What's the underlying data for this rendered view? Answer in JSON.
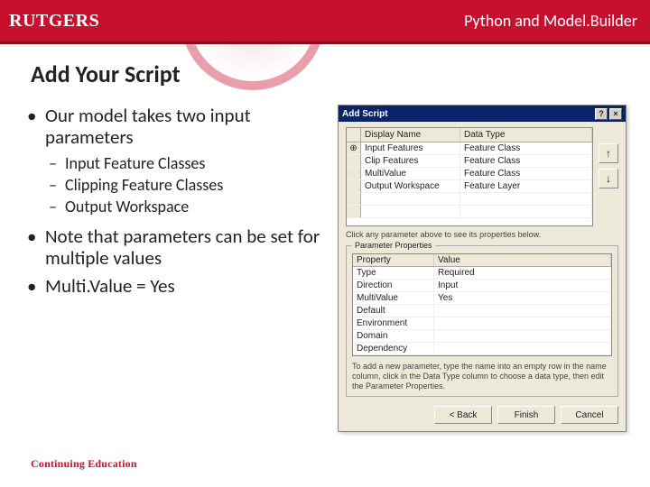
{
  "header": {
    "logo": "RUTGERS",
    "title": "Python and Model.Builder"
  },
  "slide_title": "Add Your Script",
  "bullets": {
    "b1": "Our model takes two input parameters",
    "b1a": "Input Feature Classes",
    "b1b": "Clipping Feature Classes",
    "b1c": "Output Workspace",
    "b2": "Note that parameters can be set for multiple values",
    "b3": "Multi.Value = Yes"
  },
  "footer": "Continuing Education",
  "dialog": {
    "title": "Add Script",
    "help": "?",
    "close": "×",
    "grid_headers": {
      "dn": "Display Name",
      "dt": "Data Type"
    },
    "marker": "⊕",
    "rows": [
      {
        "dn": "Input Features",
        "dt": "Feature Class"
      },
      {
        "dn": "Clip Features",
        "dt": "Feature Class"
      },
      {
        "dn": "MultiValue",
        "dt": "Feature Class"
      },
      {
        "dn": "Output Workspace",
        "dt": "Feature Layer"
      }
    ],
    "arrow_up": "↑",
    "arrow_down": "↓",
    "hint1": "Click any parameter above to see its properties below.",
    "props_legend": "Parameter Properties",
    "props_headers": {
      "p": "Property",
      "v": "Value"
    },
    "props": [
      {
        "p": "Type",
        "v": "Required"
      },
      {
        "p": "Direction",
        "v": "Input"
      },
      {
        "p": "MultiValue",
        "v": "Yes"
      },
      {
        "p": "Default",
        "v": ""
      },
      {
        "p": "Environment",
        "v": ""
      },
      {
        "p": "Domain",
        "v": ""
      },
      {
        "p": "Dependency",
        "v": ""
      }
    ],
    "hint2": "To add a new parameter, type the name into an empty row in the name column, click in the Data Type column to choose a data type, then edit the Parameter Properties.",
    "buttons": {
      "back": "< Back",
      "finish": "Finish",
      "cancel": "Cancel"
    }
  }
}
